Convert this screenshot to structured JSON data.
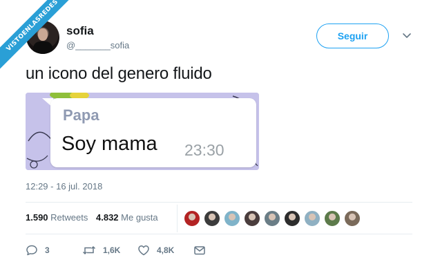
{
  "watermark": {
    "text": "VISTOENLASREDES"
  },
  "user": {
    "name": "sofia",
    "handle": "@_______sofia"
  },
  "follow_button": {
    "label": "Seguir"
  },
  "tweet": {
    "text": "un icono del genero fluido",
    "timestamp": "12:29 - 16 jul. 2018"
  },
  "media": {
    "chat_sender": "Papa",
    "chat_message": "Soy mama",
    "chat_time": "23:30"
  },
  "stats": {
    "retweets_count": "1.590",
    "retweets_label": "Retweets",
    "likes_count": "4.832",
    "likes_label": "Me gusta"
  },
  "likers": [
    {
      "color": "#b32323"
    },
    {
      "color": "#3c3c3c"
    },
    {
      "color": "#7fb3c9"
    },
    {
      "color": "#4a3d3d"
    },
    {
      "color": "#6a7d86"
    },
    {
      "color": "#2d2d2d"
    },
    {
      "color": "#8fb0c2"
    },
    {
      "color": "#5c7a4a"
    },
    {
      "color": "#7a6a5a"
    }
  ],
  "actions": {
    "reply_count": "3",
    "retweet_count": "1,6K",
    "like_count": "4,8K"
  },
  "colors": {
    "brand_blue": "#1da1f2",
    "muted_text": "#657786",
    "media_bg": "#c6c2ea"
  }
}
